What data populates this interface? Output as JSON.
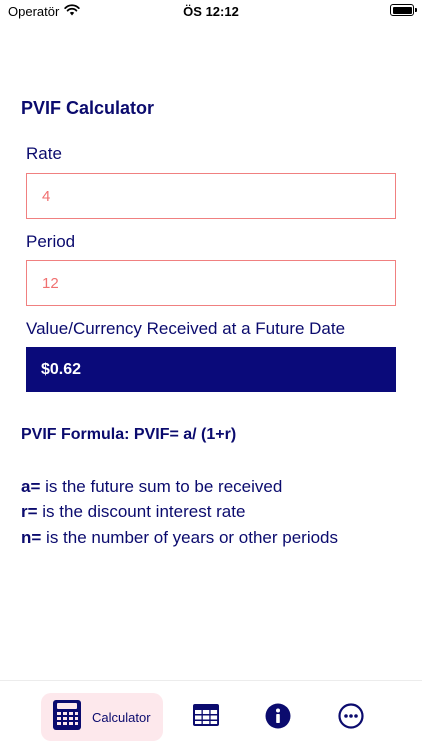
{
  "status_bar": {
    "carrier": "Operatör",
    "time": "ÖS 12:12",
    "icons": [
      "wifi-icon",
      "battery-icon"
    ]
  },
  "page": {
    "title": "PVIF Calculator"
  },
  "fields": [
    {
      "label": "Rate",
      "value": "4"
    },
    {
      "label": "Period",
      "value": "12"
    }
  ],
  "result": {
    "label": "Value/Currency Received at a Future Date",
    "value": "$0.62"
  },
  "formula": {
    "text": "PVIF Formula: PVIF= a/ (1+r)"
  },
  "definitions": [
    {
      "symbol": "a=",
      "text": " is the future sum to be received"
    },
    {
      "symbol": "r=",
      "text": " is the discount interest rate"
    },
    {
      "symbol": "n=",
      "text": " is the number of years or other periods"
    }
  ],
  "tab_bar": {
    "active_index": 0,
    "tabs": [
      {
        "label": "Calculator",
        "icon": "calculator-icon"
      },
      {
        "label": "",
        "icon": "table-icon"
      },
      {
        "label": "",
        "icon": "info-icon"
      },
      {
        "label": "",
        "icon": "more-icon"
      }
    ]
  },
  "colors": {
    "primary": "#0b0b6e",
    "result_bg": "#0a0a7a",
    "input_border": "#f08080",
    "input_text": "#f07070",
    "tab_active_bg": "#fde8ec"
  }
}
